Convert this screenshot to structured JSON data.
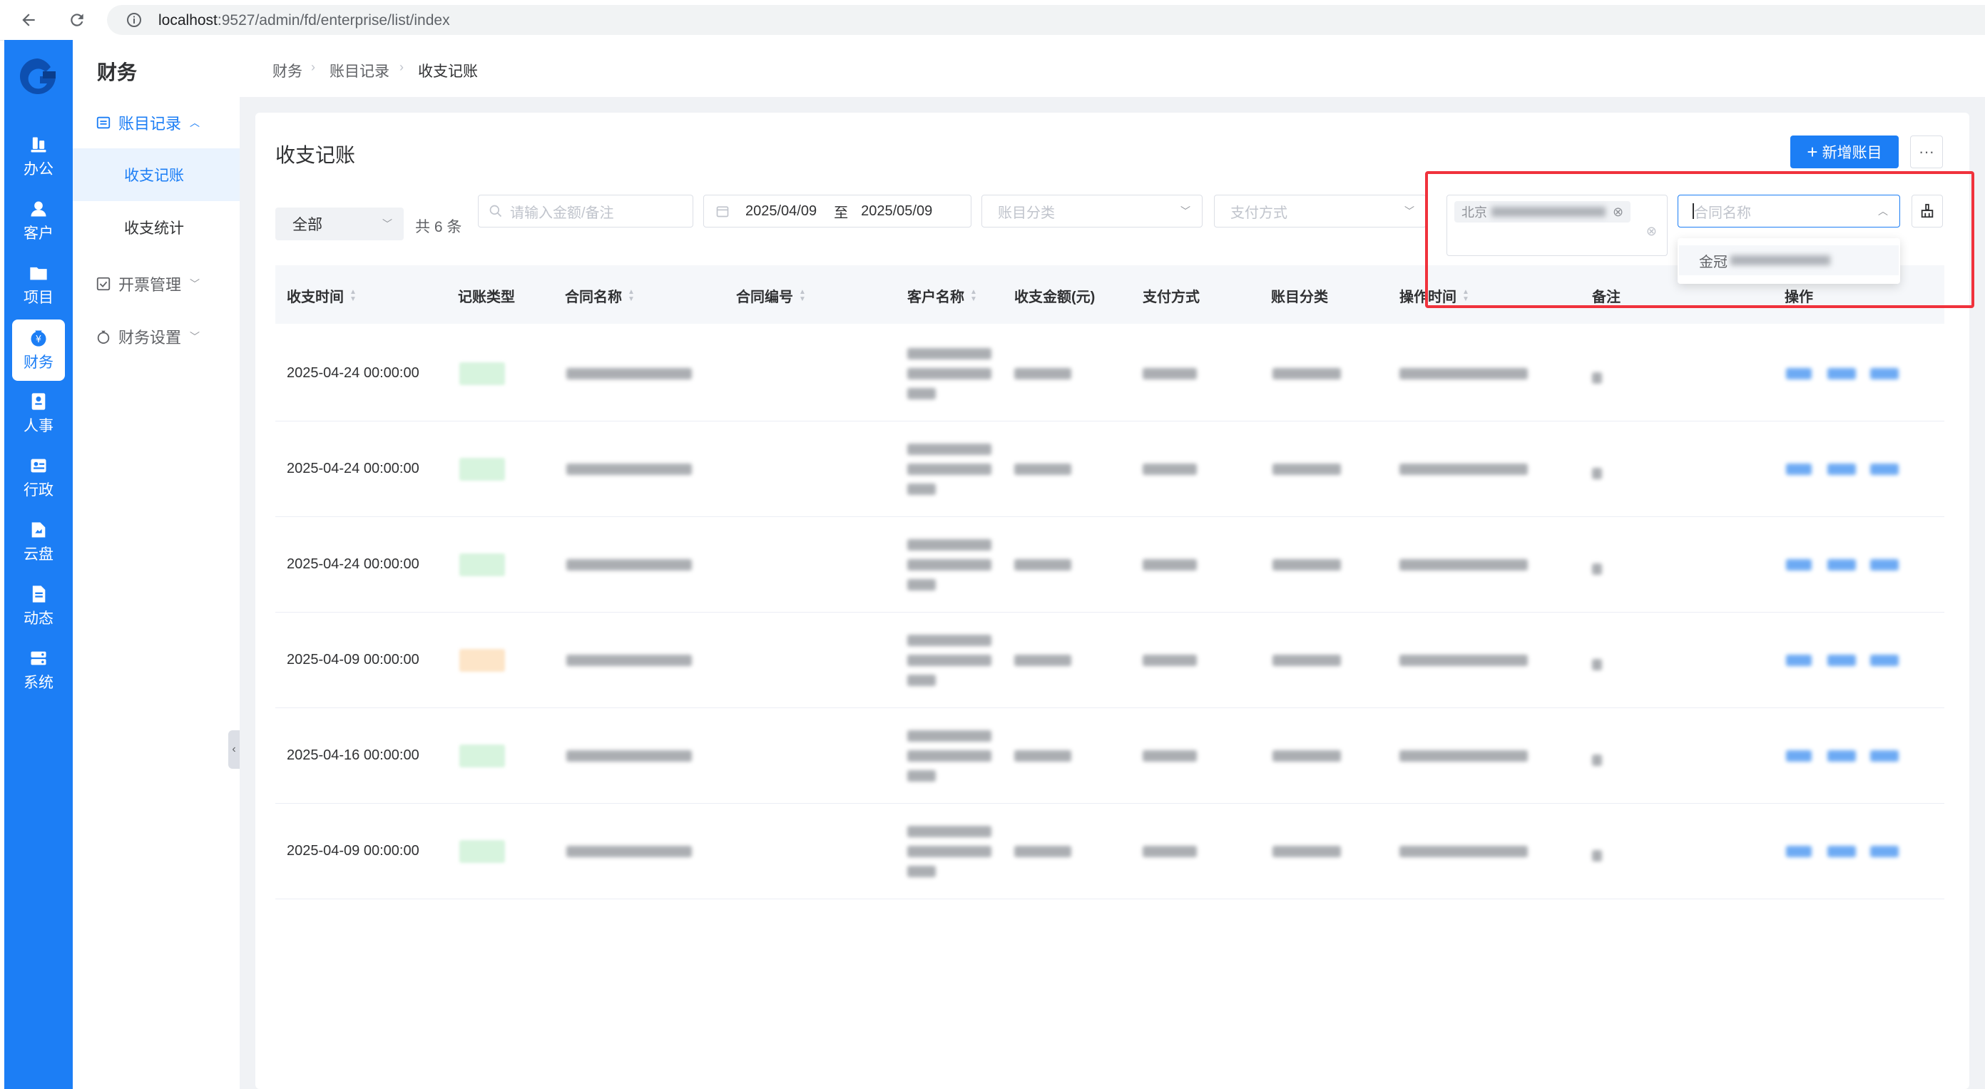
{
  "browser": {
    "url_host": "localhost",
    "url_path": ":9527/admin/fd/enterprise/list/index"
  },
  "left_nav": {
    "items": [
      {
        "label": "办公",
        "icon": "office-icon"
      },
      {
        "label": "客户",
        "icon": "customer-icon"
      },
      {
        "label": "项目",
        "icon": "project-icon"
      },
      {
        "label": "财务",
        "icon": "finance-icon",
        "active": true
      },
      {
        "label": "人事",
        "icon": "hr-icon"
      },
      {
        "label": "行政",
        "icon": "admin-icon"
      },
      {
        "label": "云盘",
        "icon": "cloud-disk-icon"
      },
      {
        "label": "动态",
        "icon": "feed-icon"
      },
      {
        "label": "系统",
        "icon": "system-icon"
      }
    ]
  },
  "sidebar": {
    "title": "财务",
    "groups": [
      {
        "label": "账目记录",
        "expanded": true,
        "children": [
          "收支记账",
          "收支统计"
        ]
      },
      {
        "label": "开票管理",
        "expanded": false
      },
      {
        "label": "财务设置",
        "expanded": false
      }
    ]
  },
  "breadcrumb": [
    "财务",
    "账目记录",
    "收支记账"
  ],
  "page": {
    "title": "收支记账",
    "add_button": "新增账目",
    "more_button": "···"
  },
  "filters": {
    "type_select": "全部",
    "count_text": "共 6 条",
    "search_placeholder": "请输入金额/备注",
    "date_start": "2025/04/09",
    "date_sep": "至",
    "date_end": "2025/05/09",
    "category_placeholder": "账目分类",
    "payment_placeholder": "支付方式",
    "customer_tag": "北京",
    "contract_placeholder": "合同名称"
  },
  "dropdown": {
    "option_prefix": "金冠"
  },
  "table": {
    "columns": [
      "收支时间",
      "记账类型",
      "合同名称",
      "合同编号",
      "客户名称",
      "收支金额(元)",
      "支付方式",
      "账目分类",
      "操作时间",
      "备注",
      "操作"
    ],
    "rows": [
      {
        "time": "2025-04-24 00:00:00",
        "type": "in"
      },
      {
        "time": "2025-04-24 00:00:00",
        "type": "in"
      },
      {
        "time": "2025-04-24 00:00:00",
        "type": "in"
      },
      {
        "time": "2025-04-09 00:00:00",
        "type": "out"
      },
      {
        "time": "2025-04-16 00:00:00",
        "type": "in"
      },
      {
        "time": "2025-04-09 00:00:00",
        "type": "in"
      }
    ]
  },
  "colors": {
    "primary": "#1c7ef5",
    "highlight": "#f0323c"
  }
}
